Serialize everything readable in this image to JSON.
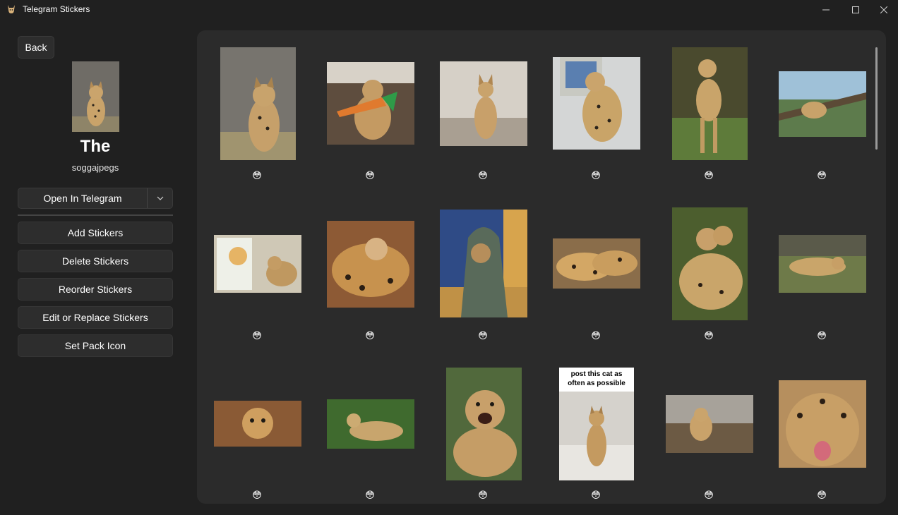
{
  "window": {
    "title": "Telegram Stickers"
  },
  "sidebar": {
    "back_label": "Back",
    "pack_title": "The",
    "pack_author": "soggajpegs",
    "open_label": "Open In Telegram",
    "actions": [
      "Add Stickers",
      "Delete Stickers",
      "Reorder Stickers",
      "Edit or Replace Stickers",
      "Set Pack Icon"
    ]
  },
  "stickers": {
    "emoji": "😳",
    "meme_caption": "post this cat as often as possible",
    "count_visible": 18
  },
  "colors": {
    "background": "#202020",
    "panel": "#2b2b2b",
    "button": "#2d2d2d"
  }
}
